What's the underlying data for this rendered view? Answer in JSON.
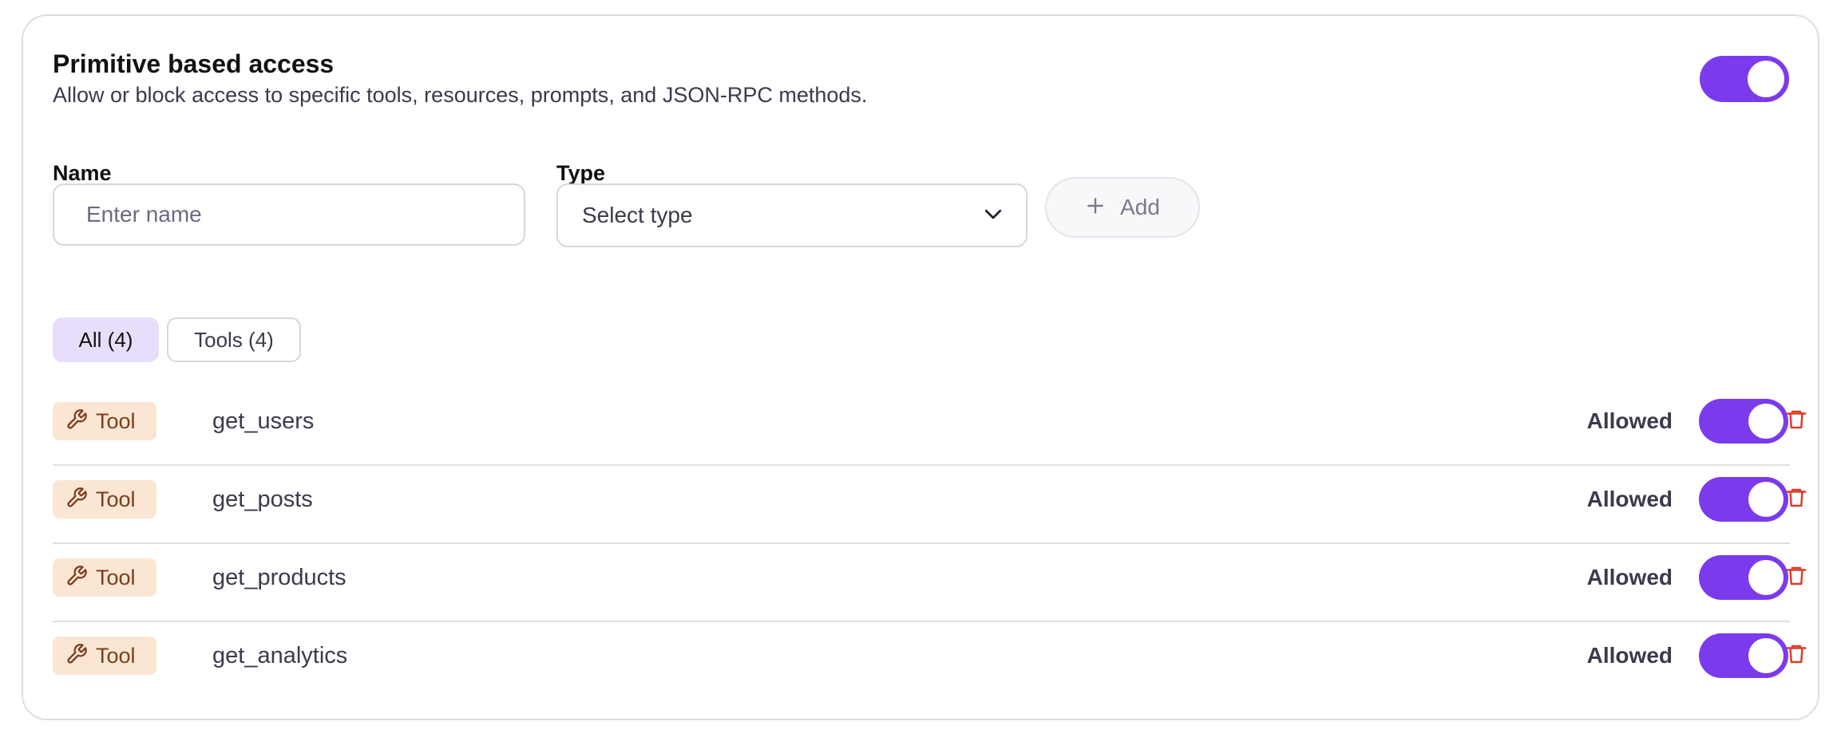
{
  "section": {
    "title": "Primitive based access",
    "description": "Allow or block access to specific tools, resources, prompts, and JSON-RPC methods.",
    "enabled": true
  },
  "form": {
    "name_label": "Name",
    "name_placeholder": "Enter name",
    "name_value": "",
    "type_label": "Type",
    "type_placeholder": "Select type",
    "add_label": "Add"
  },
  "filters": [
    {
      "label": "All (4)",
      "selected": true
    },
    {
      "label": "Tools (4)",
      "selected": false
    }
  ],
  "rows": [
    {
      "type_label": "Tool",
      "name": "get_users",
      "status": "Allowed",
      "enabled": true
    },
    {
      "type_label": "Tool",
      "name": "get_posts",
      "status": "Allowed",
      "enabled": true
    },
    {
      "type_label": "Tool",
      "name": "get_products",
      "status": "Allowed",
      "enabled": true
    },
    {
      "type_label": "Tool",
      "name": "get_analytics",
      "status": "Allowed",
      "enabled": true
    }
  ],
  "icons": {
    "add": "plus-icon",
    "select": "chevron-down-icon",
    "tool": "wrench-icon",
    "delete": "trash-icon"
  },
  "colors": {
    "accent": "#7c3aed",
    "badge_bg": "#fbe6d4",
    "badge_text": "#7c3d1d",
    "delete": "#d9402b",
    "filter_selected_bg": "#e8defb"
  }
}
